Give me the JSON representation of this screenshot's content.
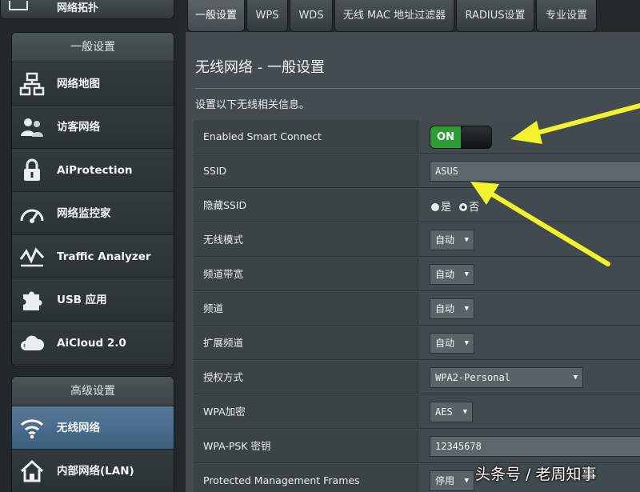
{
  "sidebar": {
    "top_item": {
      "label": "网络拓扑",
      "icon": "router-icon"
    },
    "general_title": "一般设置",
    "general_items": [
      {
        "label": "网络地图",
        "icon": "network-map-icon"
      },
      {
        "label": "访客网络",
        "icon": "guest-network-icon"
      },
      {
        "label": "AiProtection",
        "icon": "lock-icon"
      },
      {
        "label": "网络监控家",
        "icon": "gauge-icon"
      },
      {
        "label": "Traffic Analyzer",
        "icon": "traffic-analyzer-icon"
      },
      {
        "label": "USB 应用",
        "icon": "puzzle-icon"
      },
      {
        "label": "AiCloud 2.0",
        "icon": "cloud-icon"
      }
    ],
    "advanced_title": "高级设置",
    "advanced_items": [
      {
        "label": "无线网络",
        "icon": "wifi-icon",
        "active": true
      },
      {
        "label": "内部网络(LAN)",
        "icon": "home-icon"
      }
    ]
  },
  "tabs": [
    {
      "label": "一般设置",
      "active": true
    },
    {
      "label": "WPS"
    },
    {
      "label": "WDS"
    },
    {
      "label": "无线 MAC 地址过滤器"
    },
    {
      "label": "RADIUS设置"
    },
    {
      "label": "专业设置"
    }
  ],
  "main": {
    "title": "无线网络 - 一般设置",
    "description": "设置以下无线相关信息。",
    "rows": {
      "smart_connect": {
        "label": "Enabled Smart Connect",
        "value": "ON"
      },
      "ssid": {
        "label": "SSID",
        "value": "ASUS"
      },
      "hide_ssid": {
        "label": "隐藏SSID",
        "option_yes": "是",
        "option_no": "否",
        "selected": "否"
      },
      "wireless_mode": {
        "label": "无线模式",
        "value": "自动"
      },
      "bandwidth": {
        "label": "频道带宽",
        "value": "自动"
      },
      "channel": {
        "label": "频道",
        "value": "自动"
      },
      "ext_channel": {
        "label": "扩展频道",
        "value": "自动"
      },
      "auth_method": {
        "label": "授权方式",
        "value": "WPA2-Personal"
      },
      "wpa_encryption": {
        "label": "WPA加密",
        "value": "AES"
      },
      "wpa_psk": {
        "label": "WPA-PSK 密钥",
        "value": "12345678"
      },
      "pmf": {
        "label": "Protected Management Frames",
        "value": "停用"
      }
    }
  },
  "watermark": "头条号 / 老周知事",
  "colors": {
    "toggle_on": "#2d9c34",
    "arrow": "#f3f22e",
    "active_menu": "#4a6b8c"
  }
}
